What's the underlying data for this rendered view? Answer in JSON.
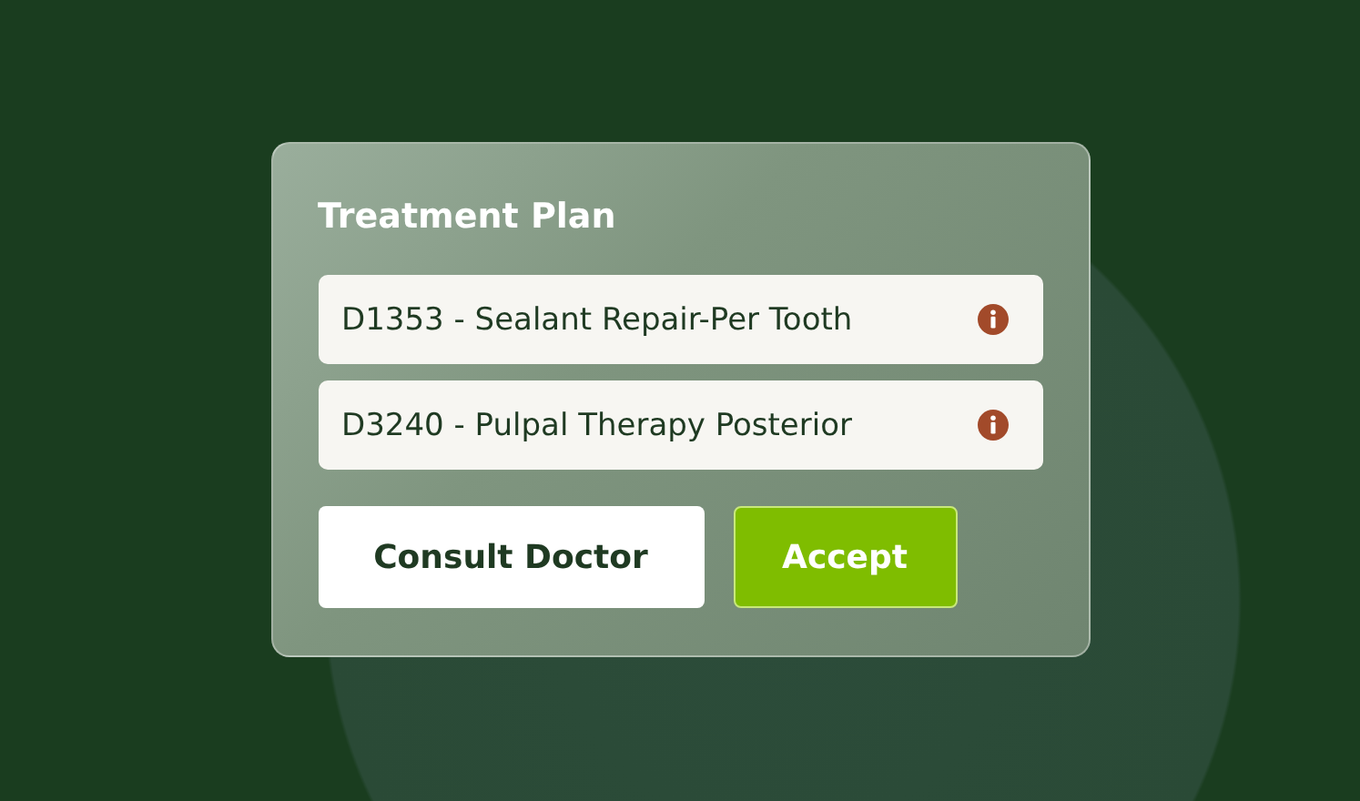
{
  "card": {
    "title": "Treatment Plan",
    "procedures": [
      {
        "label": "D1353 - Sealant Repair-Per Tooth"
      },
      {
        "label": "D3240 - Pulpal Therapy Posterior"
      }
    ],
    "buttons": [
      {
        "label": "Consult Doctor",
        "kind": "secondary"
      },
      {
        "label": "Accept",
        "kind": "primary"
      }
    ]
  }
}
